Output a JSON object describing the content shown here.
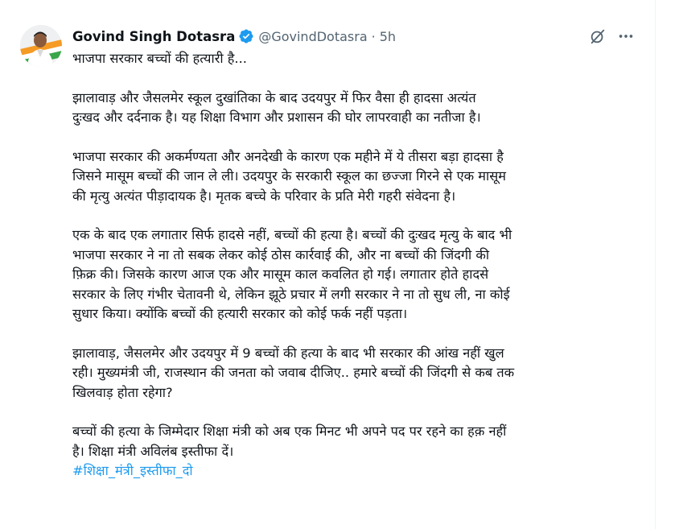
{
  "author": {
    "name": "Govind Singh Dotasra",
    "handle": "@GovindDotasra",
    "separator": "·",
    "time": "5h",
    "verified_color": "#1d9bf0"
  },
  "actions": {
    "grok_icon": "grok-slash-circle-icon",
    "more_icon": "more-horizontal-icon"
  },
  "tweet": {
    "line_1": "भाजपा सरकार बच्चों की हत्यारी है...",
    "para_1_line_1": "झालावाड़ और जैसलमेर स्कूल दुखांतिका के बाद उदयपुर में फिर वैसा ही हादसा अत्यंत",
    "para_1_line_2": "दुःखद और दर्दनाक है। यह शिक्षा विभाग और प्रशासन की घोर लापरवाही का नतीजा है।",
    "para_2_line_1": "भाजपा सरकार की अकर्मण्यता और अनदेखी के कारण एक महीने में ये तीसरा बड़ा हादसा है",
    "para_2_line_2": "जिसने मासूम बच्चों की जान ले ली। उदयपुर के सरकारी स्कूल का छज्जा गिरने से एक मासूम",
    "para_2_line_3": "की मृत्यु अत्यंत पीड़ादायक है। मृतक बच्चे के परिवार के प्रति मेरी गहरी संवेदना है।",
    "para_3_line_1": "एक के बाद एक लगातार सिर्फ हादसे नहीं, बच्चों की हत्या है। बच्चों की दुःखद मृत्यु के बाद भी",
    "para_3_line_2": "भाजपा सरकार ने ना तो सबक लेकर कोई ठोस कार्रवाई की, और ना बच्चों की जिंदगी की",
    "para_3_line_3": "फ़िक्र की। जिसके कारण आज एक और मासूम काल कवलित हो गई। लगातार होते हादसे",
    "para_3_line_4": "सरकार के लिए गंभीर चेतावनी थे, लेकिन झूठे प्रचार में लगी सरकार ने ना तो सुध ली, ना कोई",
    "para_3_line_5": "सुधार किया। क्योंकि बच्चों की हत्यारी सरकार को कोई फर्क नहीं पड़ता।",
    "para_4_line_1": "झालावाड़, जैसलमेर और उदयपुर में 9 बच्चों की हत्या के बाद भी सरकार की आंख नहीं खुल",
    "para_4_line_2": "रही। मुख्यमंत्री जी, राजस्थान की जनता को जवाब दीजिए.. हमारे बच्चों की जिंदगी से कब तक",
    "para_4_line_3": "खिलवाड़ होता रहेगा?",
    "para_5_line_1": "बच्चों की हत्या के जिम्मेदार शिक्षा मंत्री को अब एक मिनट भी अपने पद पर रहने का हक़ नहीं",
    "para_5_line_2": "है। शिक्षा मंत्री अविलंब इस्तीफा दें।",
    "hashtag": "#शिक्षा_मंत्री_इस्तीफा_दो",
    "hashtag_color": "#1d9bf0"
  }
}
